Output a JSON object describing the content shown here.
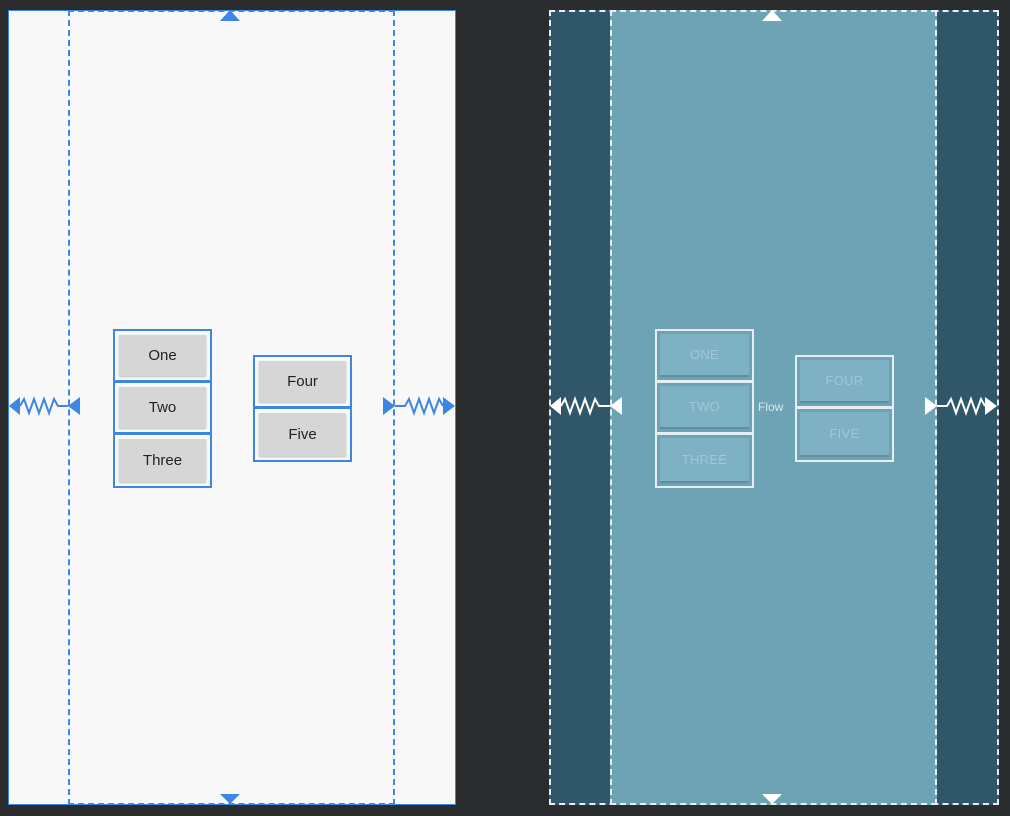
{
  "design": {
    "buttons": [
      "One",
      "Two",
      "Three",
      "Four",
      "Five"
    ]
  },
  "blueprint": {
    "flow_label": "Flow",
    "buttons": [
      "ONE",
      "TWO",
      "THREE",
      "FOUR",
      "FIVE"
    ]
  },
  "colors": {
    "background": "#2b2c2e",
    "design_canvas": "#f8f8f9",
    "design_accent": "#3d86e3",
    "button_face": "#d6d6d6",
    "blueprint_dark": "#2f5669",
    "blueprint_light": "#6ea2b5",
    "blueprint_line": "#e6eef2"
  },
  "icons": {
    "top_anchor": "triangle-up-icon",
    "bottom_anchor": "triangle-down-icon",
    "left_anchor": "triangle-left-icon",
    "right_anchor": "triangle-right-icon",
    "spring": "zigzag-constraint-icon"
  }
}
